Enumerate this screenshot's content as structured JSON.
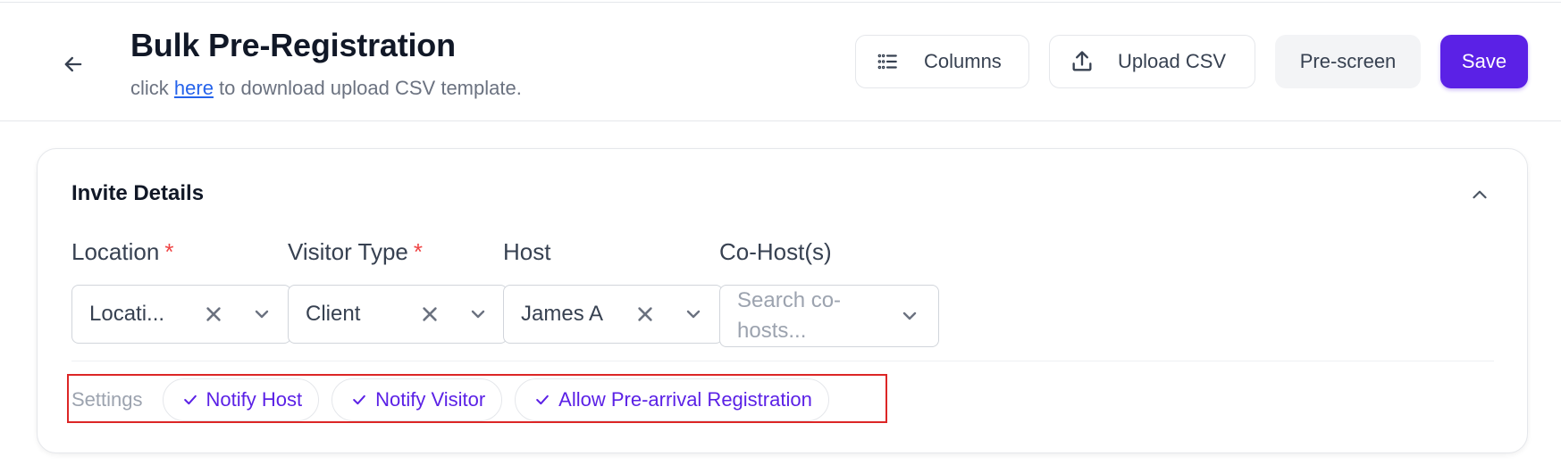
{
  "header": {
    "title": "Bulk Pre-Registration",
    "subtitle_prefix": "click ",
    "subtitle_link": "here",
    "subtitle_suffix": " to download upload CSV template.",
    "buttons": {
      "columns": "Columns",
      "upload_csv": "Upload CSV",
      "prescreen": "Pre-screen",
      "save": "Save"
    }
  },
  "card": {
    "title": "Invite Details",
    "fields": {
      "location": {
        "label": "Location",
        "value": "Locati..."
      },
      "visitor_type": {
        "label": "Visitor Type",
        "value": "Client"
      },
      "host": {
        "label": "Host",
        "value": "James A"
      },
      "cohosts": {
        "label": "Co-Host(s)",
        "placeholder": "Search co-hosts..."
      }
    },
    "required_mark": "*",
    "settings": {
      "label": "Settings",
      "chips": [
        "Notify Host",
        "Notify Visitor",
        "Allow Pre-arrival Registration"
      ]
    }
  },
  "colors": {
    "accent": "#5b21e6",
    "required": "#ef4444",
    "link": "#2563eb",
    "highlight_box": "#dc2626"
  },
  "icons": [
    "arrow-left-icon",
    "list-icon",
    "upload-icon",
    "chevron-up-icon",
    "clear-icon",
    "chevron-down-icon",
    "check-icon"
  ]
}
